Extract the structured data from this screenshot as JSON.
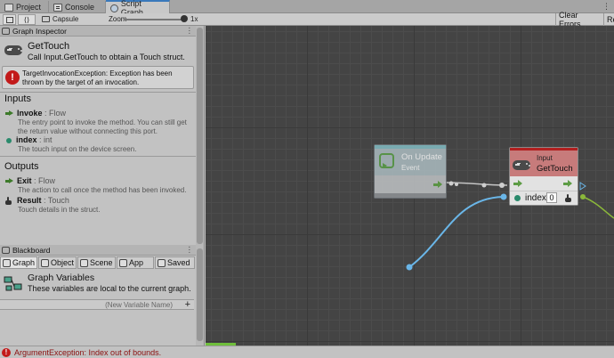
{
  "tabs": [
    {
      "label": "Project",
      "icon": "folder-icon"
    },
    {
      "label": "Console",
      "icon": "console-icon"
    },
    {
      "label": "Script Graph",
      "icon": "script-graph-icon",
      "active": true
    }
  ],
  "toolbar": {
    "breadcrumb": "Capsule",
    "zoom_label": "Zoom",
    "zoom_value": "1x",
    "zoom_level": 1.0,
    "clear_errors": "Clear Errors",
    "relations": "Re"
  },
  "inspector": {
    "header": "Graph Inspector",
    "unit_title": "GetTouch",
    "unit_summary": "Call Input.GetTouch to obtain a Touch struct.",
    "error_message": "TargetInvocationException: Exception has been thrown by the target of an invocation.",
    "inputs_title": "Inputs",
    "inputs": [
      {
        "name": "Invoke",
        "type": " : Flow",
        "description": "The entry point to invoke the method. You can still get the return value without connecting this port.",
        "icon": "flow-arrow-icon"
      },
      {
        "name": "index",
        "type": " : int",
        "description": "The touch input on the device screen.",
        "icon": "int-port-icon"
      }
    ],
    "outputs_title": "Outputs",
    "outputs": [
      {
        "name": "Exit",
        "type": " : Flow",
        "description": "The action to call once the method has been invoked.",
        "icon": "flow-arrow-icon"
      },
      {
        "name": "Result",
        "type": " : Touch",
        "description": "Touch details in the struct.",
        "icon": "touch-hand-icon"
      }
    ]
  },
  "blackboard": {
    "header": "Blackboard",
    "tabs": [
      "Graph",
      "Object",
      "Scene",
      "App",
      "Saved"
    ],
    "active_tab": "Graph",
    "section_title": "Graph Variables",
    "section_desc": "These variables are local to the current graph.",
    "new_variable_placeholder": "(New Variable Name)",
    "add_label": "+"
  },
  "graph": {
    "on_update": {
      "title": "On Update",
      "subtitle": "Event"
    },
    "get_touch": {
      "category": "Input",
      "title": "GetTouch",
      "index_label": "index",
      "index_value": "0"
    },
    "colors": {
      "flow": "#5d9c44",
      "value": "#6ab6e8",
      "error_header": "#b12020"
    }
  },
  "status": {
    "message": "ArgumentException: Index out of bounds."
  }
}
